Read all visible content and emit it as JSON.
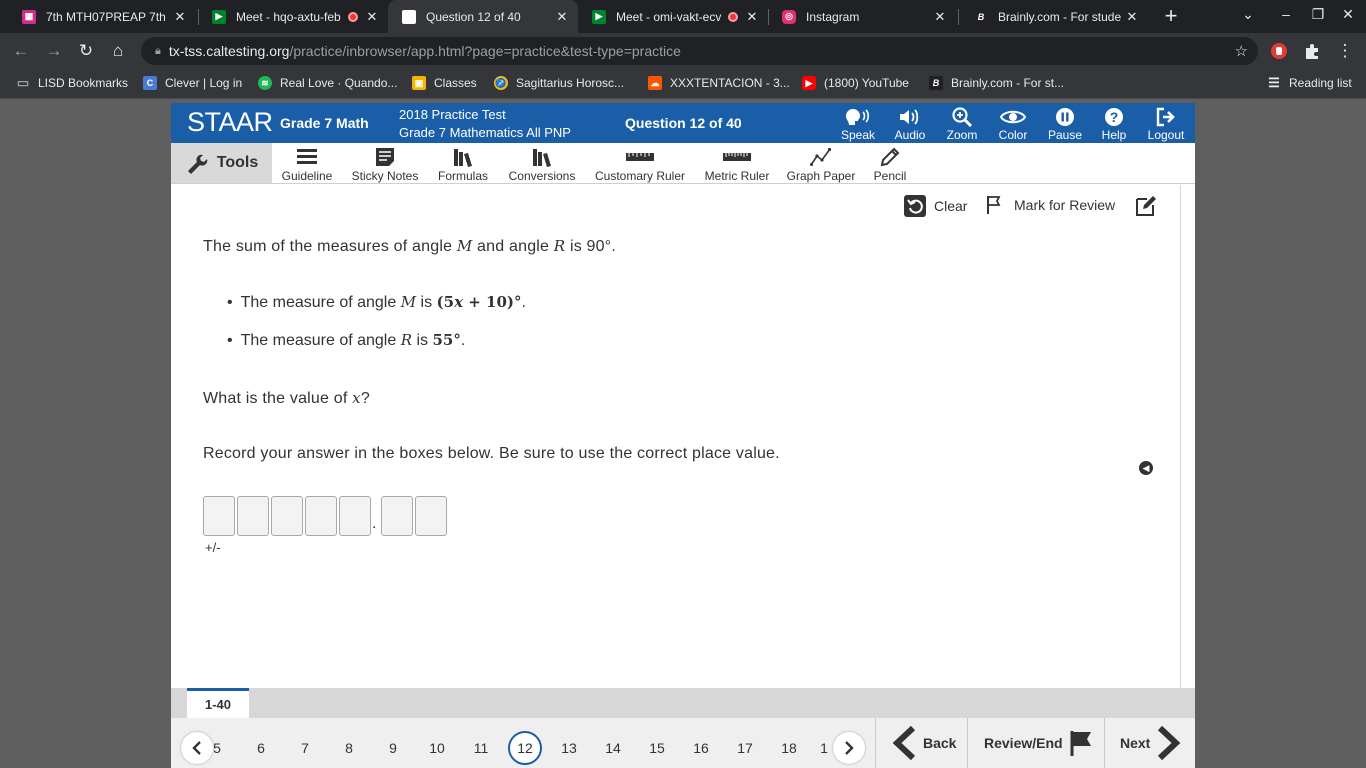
{
  "browser": {
    "tabs": [
      {
        "title": "7th MTH07PREAP 7th",
        "favicon_color": "#d02f88",
        "recording": false,
        "active": false
      },
      {
        "title": "Meet - hqo-axtu-feb",
        "favicon_color": "#00832d",
        "recording": true,
        "active": false
      },
      {
        "title": "Question 12 of 40",
        "favicon_color": "#ffffff",
        "recording": false,
        "active": true
      },
      {
        "title": "Meet - omi-vakt-ecv",
        "favicon_color": "#00832d",
        "recording": true,
        "active": false
      },
      {
        "title": "Instagram",
        "favicon_color": "#e1306c",
        "recording": false,
        "active": false
      },
      {
        "title": "Brainly.com - For stude",
        "favicon_color": "#202124",
        "recording": false,
        "active": false
      }
    ],
    "url_host": "tx-tss.caltesting.org",
    "url_path": "/practice/inbrowser/app.html?page=practice&test-type=practice",
    "bookmarks": [
      {
        "label": "LISD Bookmarks",
        "icon": "folder-icon"
      },
      {
        "label": "Clever | Log in",
        "icon": "clever-icon"
      },
      {
        "label": "Real Love · Quando...",
        "icon": "spotify-icon"
      },
      {
        "label": "Classes",
        "icon": "classroom-icon"
      },
      {
        "label": "Sagittarius Horosc...",
        "icon": "horoscope-icon"
      },
      {
        "label": "XXXTENTACION - 3...",
        "icon": "soundcloud-icon"
      },
      {
        "label": "(1800) YouTube",
        "icon": "youtube-icon"
      },
      {
        "label": "Brainly.com - For st...",
        "icon": "brainly-icon"
      }
    ],
    "reading_list": "Reading list"
  },
  "app": {
    "logo": "STAAR",
    "grade": "Grade 7 Math",
    "test_line1": "2018 Practice Test",
    "test_line2": "Grade 7 Mathematics All PNP",
    "question_count": "Question 12 of 40",
    "header_buttons": [
      {
        "label": "Speak",
        "icon": "speak-icon"
      },
      {
        "label": "Audio",
        "icon": "audio-icon"
      },
      {
        "label": "Zoom",
        "icon": "zoom-icon"
      },
      {
        "label": "Color",
        "icon": "color-eye-icon"
      },
      {
        "label": "Pause",
        "icon": "pause-icon"
      },
      {
        "label": "Help",
        "icon": "help-icon"
      },
      {
        "label": "Logout",
        "icon": "logout-icon"
      }
    ],
    "tools_label": "Tools",
    "tools": [
      {
        "label": "Guideline",
        "icon": "guideline-icon"
      },
      {
        "label": "Sticky Notes",
        "icon": "sticky-notes-icon"
      },
      {
        "label": "Formulas",
        "icon": "formulas-icon"
      },
      {
        "label": "Conversions",
        "icon": "conversions-icon"
      },
      {
        "label": "Customary Ruler",
        "icon": "customary-ruler-icon"
      },
      {
        "label": "Metric Ruler",
        "icon": "metric-ruler-icon"
      },
      {
        "label": "Graph Paper",
        "icon": "graph-paper-icon"
      },
      {
        "label": "Pencil",
        "icon": "pencil-icon"
      }
    ],
    "actions": {
      "clear": "Clear",
      "mark_review": "Mark for Review"
    },
    "colors": {
      "header_blue": "#1b5ea8",
      "nav_bg": "#efefef"
    }
  },
  "question": {
    "stem_pre": "The sum of the measures of angle ",
    "stem_m": "M",
    "stem_mid": " and angle ",
    "stem_r": "R",
    "stem_post": " is 90°.",
    "bullet1_pre": "The measure of angle ",
    "bullet1_var": "M",
    "bullet1_mid": " is ",
    "bullet1_expr_open": "(5",
    "bullet1_expr_x": "x",
    "bullet1_expr_close": " + 10)°",
    "bullet1_end": ".",
    "bullet2_pre": "The measure of angle ",
    "bullet2_var": "R",
    "bullet2_mid": " is ",
    "bullet2_value": "55°",
    "bullet2_end": ".",
    "prompt_pre": "What is the value of ",
    "prompt_var": "x",
    "prompt_post": "?",
    "instructions": "Record your answer in the boxes below. Be sure to use the correct place value.",
    "answer_boxes_before_decimal": 5,
    "answer_boxes_after_decimal": 2,
    "decimal_point": ".",
    "sign_label": "+/-"
  },
  "navigation": {
    "range_tab": "1-40",
    "question_numbers": [
      "5",
      "6",
      "7",
      "8",
      "9",
      "10",
      "11",
      "12",
      "13",
      "14",
      "15",
      "16",
      "17",
      "18",
      "1"
    ],
    "current": "12",
    "back": "Back",
    "review_end": "Review/End",
    "next": "Next"
  }
}
